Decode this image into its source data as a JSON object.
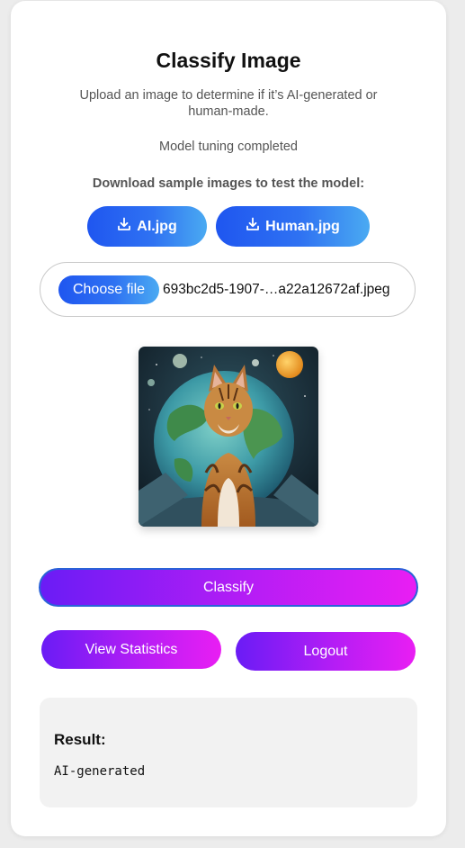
{
  "header": {
    "title": "Classify Image",
    "subtitle": "Upload an image to determine if it’s AI-generated or human-made.",
    "status": "Model tuning completed"
  },
  "samples": {
    "heading": "Download sample images to test the model:",
    "ai_label": "AI.jpg",
    "human_label": "Human.jpg",
    "icon": "download-icon"
  },
  "upload": {
    "button_label": "Choose file",
    "file_name": "693bc2d5-1907-…a22a12672af.jpeg"
  },
  "preview": {
    "image": "image-preview"
  },
  "actions": {
    "classify_label": "Classify",
    "stats_label": "View Statistics",
    "logout_label": "Logout"
  },
  "result": {
    "label": "Result:",
    "value": "AI-generated"
  },
  "colors": {
    "blue_gradient": [
      "#1f56f0",
      "#4aaaf2"
    ],
    "purple_gradient": [
      "#6a1cf5",
      "#e91ef3"
    ],
    "page_background": "#ececec"
  }
}
